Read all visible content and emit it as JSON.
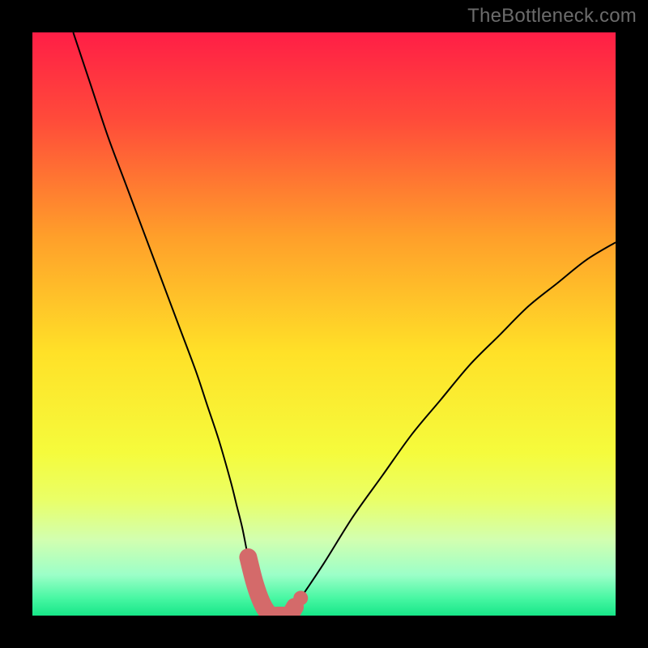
{
  "watermark": "TheBottleneck.com",
  "chart_data": {
    "type": "line",
    "title": "",
    "xlabel": "",
    "ylabel": "",
    "xlim": [
      0,
      100
    ],
    "ylim": [
      0,
      100
    ],
    "grid": false,
    "legend": false,
    "background_gradient": {
      "stops": [
        {
          "offset": 0.0,
          "color": "#ff1e46"
        },
        {
          "offset": 0.15,
          "color": "#ff4b3a"
        },
        {
          "offset": 0.35,
          "color": "#ff9f2a"
        },
        {
          "offset": 0.55,
          "color": "#ffe128"
        },
        {
          "offset": 0.72,
          "color": "#f5fb3c"
        },
        {
          "offset": 0.8,
          "color": "#eaff66"
        },
        {
          "offset": 0.87,
          "color": "#d2ffb0"
        },
        {
          "offset": 0.93,
          "color": "#9cffc8"
        },
        {
          "offset": 0.97,
          "color": "#48f7a3"
        },
        {
          "offset": 1.0,
          "color": "#17e688"
        }
      ]
    },
    "series": [
      {
        "name": "bottleneck-curve",
        "color": "#000000",
        "x": [
          7,
          10,
          13,
          16,
          19,
          22,
          25,
          28,
          30,
          32,
          34,
          35,
          36,
          37,
          38,
          39,
          40,
          41,
          42,
          44,
          46,
          50,
          55,
          60,
          65,
          70,
          75,
          80,
          85,
          90,
          95,
          100
        ],
        "y": [
          100,
          91,
          82,
          74,
          66,
          58,
          50,
          42,
          36,
          30,
          23,
          19,
          15,
          10,
          6,
          3,
          1,
          0,
          0,
          0,
          3,
          9,
          17,
          24,
          31,
          37,
          43,
          48,
          53,
          57,
          61,
          64
        ]
      }
    ],
    "highlight_segment": {
      "name": "bottom-highlight",
      "color": "#d46a6a",
      "x": [
        34,
        35,
        36,
        37,
        38,
        39,
        40,
        41,
        42,
        43,
        44,
        45,
        46
      ],
      "y": [
        23,
        19,
        15,
        10,
        6,
        3,
        1,
        0,
        0,
        0,
        0,
        1.5,
        3
      ],
      "thick_from_index": 3,
      "thick_to_index": 11,
      "extra_dot": {
        "x": 46,
        "y": 3
      }
    }
  }
}
